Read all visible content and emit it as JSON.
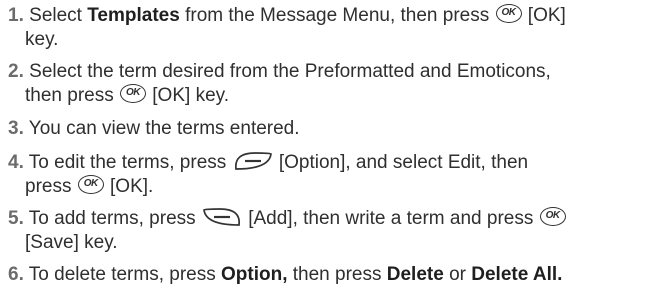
{
  "steps": [
    {
      "num": "1.",
      "l1_t1": "Select ",
      "l1_b1": "Templates",
      "l1_t2": " from the Message Menu, then press ",
      "l1_t3": " [OK]",
      "l2_t1": "key."
    },
    {
      "num": "2.",
      "l1_t1": "Select the term desired from the Preformatted and Emoticons,",
      "l2_t1": "then press ",
      "l2_t2": " [OK] key."
    },
    {
      "num": "3.",
      "l1_t1": "You can view the terms entered."
    },
    {
      "num": "4.",
      "l1_t1": "To edit the terms, press ",
      "l1_t2": " [Option], and select Edit, then",
      "l2_t1": "press ",
      "l2_t2": " [OK]."
    },
    {
      "num": "5.",
      "l1_t1": "To add terms, press ",
      "l1_t2": " [Add], then write a term and press ",
      "l2_t1": "[Save] key."
    },
    {
      "num": "6.",
      "l1_t1": "To delete terms, press ",
      "l1_b1": "Option,",
      "l1_t2": " then press ",
      "l1_b2": "Delete",
      "l1_t3": " or ",
      "l1_b3": "Delete All."
    }
  ],
  "ok_key_label": "OK",
  "icons": {
    "ok_key": "ok-key-icon",
    "left_soft_key": "left-soft-key-icon",
    "right_soft_key": "right-soft-key-icon"
  }
}
